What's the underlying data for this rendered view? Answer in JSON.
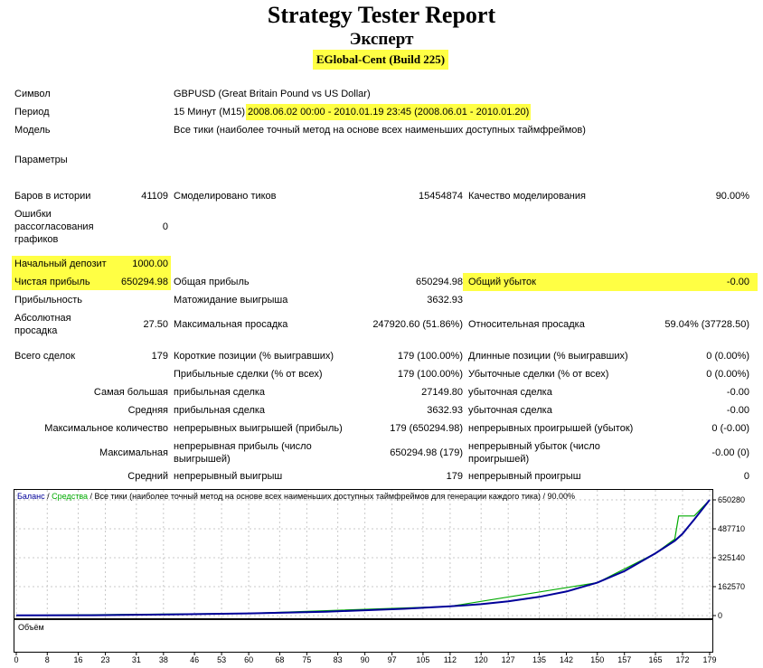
{
  "header": {
    "title": "Strategy Tester Report",
    "expert_label": "Эксперт",
    "ea_name": "EGlobal-Cent (Build 225)"
  },
  "info": {
    "symbol_label": "Символ",
    "symbol_value": "GBPUSD (Great Britain Pound vs US Dollar)",
    "period_label": "Период",
    "period_tf": "15 Минут (M15)",
    "period_range": "2008.06.02 00:00 - 2010.01.19 23:45 (2008.06.01 - 2010.01.20)",
    "model_label": "Модель",
    "model_value": "Все тики (наиболее точный метод на основе всех наименьших доступных таймфреймов)",
    "params_label": "Параметры"
  },
  "stats": {
    "bars_label": "Баров в истории",
    "bars_value": "41109",
    "ticks_label": "Смоделировано тиков",
    "ticks_value": "15454874",
    "quality_label": "Качество моделирования",
    "quality_value": "90.00%",
    "mismatch_label": "Ошибки рассогласования графиков",
    "mismatch_value": "0",
    "deposit_label": "Начальный депозит",
    "deposit_value": "1000.00",
    "net_profit_label": "Чистая прибыль",
    "net_profit_value": "650294.98",
    "gross_profit_label": "Общая прибыль",
    "gross_profit_value": "650294.98",
    "gross_loss_label": "Общий убыток",
    "gross_loss_value": "-0.00",
    "profit_factor_label": "Прибыльность",
    "expected_payoff_label": "Матожидание выигрыша",
    "expected_payoff_value": "3632.93",
    "abs_dd_label": "Абсолютная просадка",
    "abs_dd_value": "27.50",
    "max_dd_label": "Максимальная просадка",
    "max_dd_value": "247920.60 (51.86%)",
    "rel_dd_label": "Относительная просадка",
    "rel_dd_value": "59.04% (37728.50)",
    "total_trades_label": "Всего сделок",
    "total_trades_value": "179",
    "short_label": "Короткие позиции (% выигравших)",
    "short_value": "179 (100.00%)",
    "long_label": "Длинные позиции (% выигравших)",
    "long_value": "0 (0.00%)",
    "profit_trades_label": "Прибыльные сделки (% от всех)",
    "profit_trades_value": "179 (100.00%)",
    "loss_trades_label": "Убыточные сделки (% от всех)",
    "loss_trades_value": "0 (0.00%)",
    "largest_label": "Самая большая",
    "largest_profit_label": "прибыльная сделка",
    "largest_profit_value": "27149.80",
    "largest_loss_label": "убыточная сделка",
    "largest_loss_value": "-0.00",
    "average_label": "Средняя",
    "avg_profit_label": "прибыльная сделка",
    "avg_profit_value": "3632.93",
    "avg_loss_label": "убыточная сделка",
    "avg_loss_value": "-0.00",
    "max_count_label": "Максимальное количество",
    "cons_wins_label": "непрерывных выигрышей (прибыль)",
    "cons_wins_value": "179 (650294.98)",
    "cons_losses_label": "непрерывных проигрышей (убыток)",
    "cons_losses_value": "0 (-0.00)",
    "maximal_label": "Максимальная",
    "cons_profit_label": "непрерывная прибыль (число выигрышей)",
    "cons_profit_value": "650294.98 (179)",
    "cons_loss_label": "непрерывный убыток (число проигрышей)",
    "cons_loss_value": "-0.00 (0)",
    "avg_cons_label": "Средний",
    "avg_cons_win_label": "непрерывный выигрыш",
    "avg_cons_win_value": "179",
    "avg_cons_loss_label": "непрерывный проигрыш",
    "avg_cons_loss_value": "0"
  },
  "chart_data": {
    "type": "line",
    "legend_balance": "Баланс",
    "legend_sep1": " / ",
    "legend_equity": "Средства",
    "legend_rest": " / Все тики (наиболее точный метод на основе всех наименьших доступных таймфреймов для генерации каждого тика) / 90.00%",
    "volume_label": "Объём",
    "y_ticks": [
      "650280",
      "487710",
      "325140",
      "162570",
      "0"
    ],
    "y_tick_values": [
      650280,
      487710,
      325140,
      162570,
      0
    ],
    "x_ticks": [
      "0",
      "8",
      "16",
      "23",
      "31",
      "38",
      "46",
      "53",
      "60",
      "68",
      "75",
      "83",
      "90",
      "97",
      "105",
      "112",
      "120",
      "127",
      "135",
      "142",
      "150",
      "157",
      "165",
      "172",
      "179"
    ],
    "ylim": [
      0,
      650280
    ],
    "xlim": [
      0,
      179
    ],
    "series": [
      {
        "name": "Баланс",
        "color": "#000099",
        "x": [
          0,
          20,
          40,
          60,
          80,
          100,
          112,
          120,
          127,
          135,
          142,
          150,
          157,
          165,
          170,
          172,
          175,
          179
        ],
        "values": [
          1000,
          2000,
          6000,
          12000,
          22000,
          38000,
          52000,
          64000,
          80000,
          105000,
          135000,
          185000,
          250000,
          350000,
          420000,
          460000,
          540000,
          650280
        ]
      },
      {
        "name": "Средства",
        "color": "#00aa00",
        "x": [
          0,
          60,
          112,
          150,
          165,
          170,
          171,
          172,
          175,
          179
        ],
        "values": [
          1000,
          12000,
          52000,
          185000,
          350000,
          430000,
          560000,
          560000,
          560000,
          650280
        ]
      }
    ]
  },
  "colors": {
    "highlight": "#ffff44",
    "balance": "#000099",
    "equity": "#00aa00",
    "grid": "#c8c8c8"
  }
}
